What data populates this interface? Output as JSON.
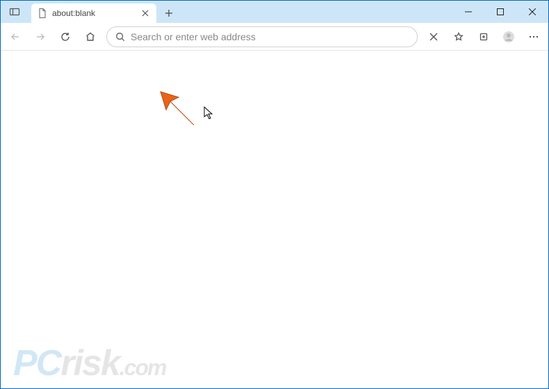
{
  "tab": {
    "title": "about:blank"
  },
  "address_bar": {
    "placeholder": "Search or enter web address",
    "value": ""
  },
  "watermark": {
    "part1": "PC",
    "part2": "risk",
    "tld": ".com"
  }
}
